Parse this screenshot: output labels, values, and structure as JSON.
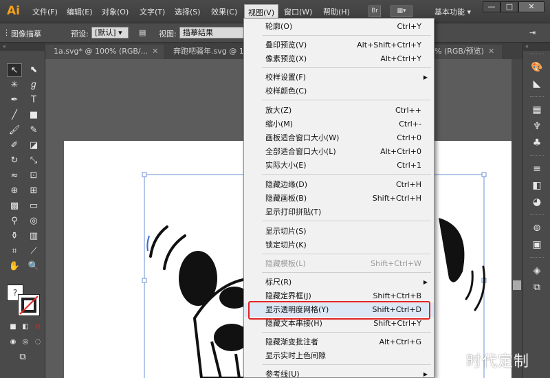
{
  "app": {
    "logo": "Ai",
    "menus": [
      "文件(F)",
      "编辑(E)",
      "对象(O)",
      "文字(T)",
      "选择(S)",
      "效果(C)",
      "视图(V)",
      "窗口(W)",
      "帮助(H)"
    ],
    "workspace_label": "基本功能",
    "bridge_label": "Br"
  },
  "controlbar": {
    "panel_label": "图像描摹",
    "preset_label": "预设:",
    "preset_value": "[默认]",
    "view_label": "视图:",
    "view_value": "描摹结果"
  },
  "tabs": [
    {
      "label": "1a.svg* @ 100% (RGB/..."
    },
    {
      "label": "奔跑吧骚年.svg @ 128"
    },
    {
      "label": "% (RGB/预览)"
    }
  ],
  "view_menu": {
    "items": [
      {
        "label": "轮廓(O)",
        "shortcut": "Ctrl+Y"
      },
      {
        "label": "叠印预览(V)",
        "shortcut": "Alt+Shift+Ctrl+Y"
      },
      {
        "label": "像素预览(X)",
        "shortcut": "Alt+Ctrl+Y"
      },
      {
        "label": "校样设置(F)",
        "shortcut": ""
      },
      {
        "label": "校样颜色(C)",
        "shortcut": ""
      },
      {
        "label": "放大(Z)",
        "shortcut": "Ctrl++"
      },
      {
        "label": "缩小(M)",
        "shortcut": "Ctrl+-"
      },
      {
        "label": "画板适合窗口大小(W)",
        "shortcut": "Ctrl+0"
      },
      {
        "label": "全部适合窗口大小(L)",
        "shortcut": "Alt+Ctrl+0"
      },
      {
        "label": "实际大小(E)",
        "shortcut": "Ctrl+1"
      },
      {
        "label": "隐藏边缘(D)",
        "shortcut": "Ctrl+H"
      },
      {
        "label": "隐藏画板(B)",
        "shortcut": "Shift+Ctrl+H"
      },
      {
        "label": "显示打印拼贴(T)",
        "shortcut": ""
      },
      {
        "label": "显示切片(S)",
        "shortcut": ""
      },
      {
        "label": "锁定切片(K)",
        "shortcut": ""
      },
      {
        "label": "隐藏模板(L)",
        "shortcut": "Shift+Ctrl+W"
      },
      {
        "label": "标尺(R)",
        "shortcut": ""
      },
      {
        "label": "隐藏定界框(J)",
        "shortcut": "Shift+Ctrl+B"
      },
      {
        "label": "显示透明度网格(Y)",
        "shortcut": "Shift+Ctrl+D"
      },
      {
        "label": "隐藏文本串接(H)",
        "shortcut": "Shift+Ctrl+Y"
      },
      {
        "label": "隐藏渐变批注者",
        "shortcut": "Alt+Ctrl+G"
      },
      {
        "label": "显示实时上色间隙",
        "shortcut": ""
      },
      {
        "label": "参考线(U)",
        "shortcut": ""
      }
    ]
  },
  "watermark": "时代定制",
  "colors": {
    "highlight_box": "#e02424",
    "logo": "#f7a11a"
  }
}
